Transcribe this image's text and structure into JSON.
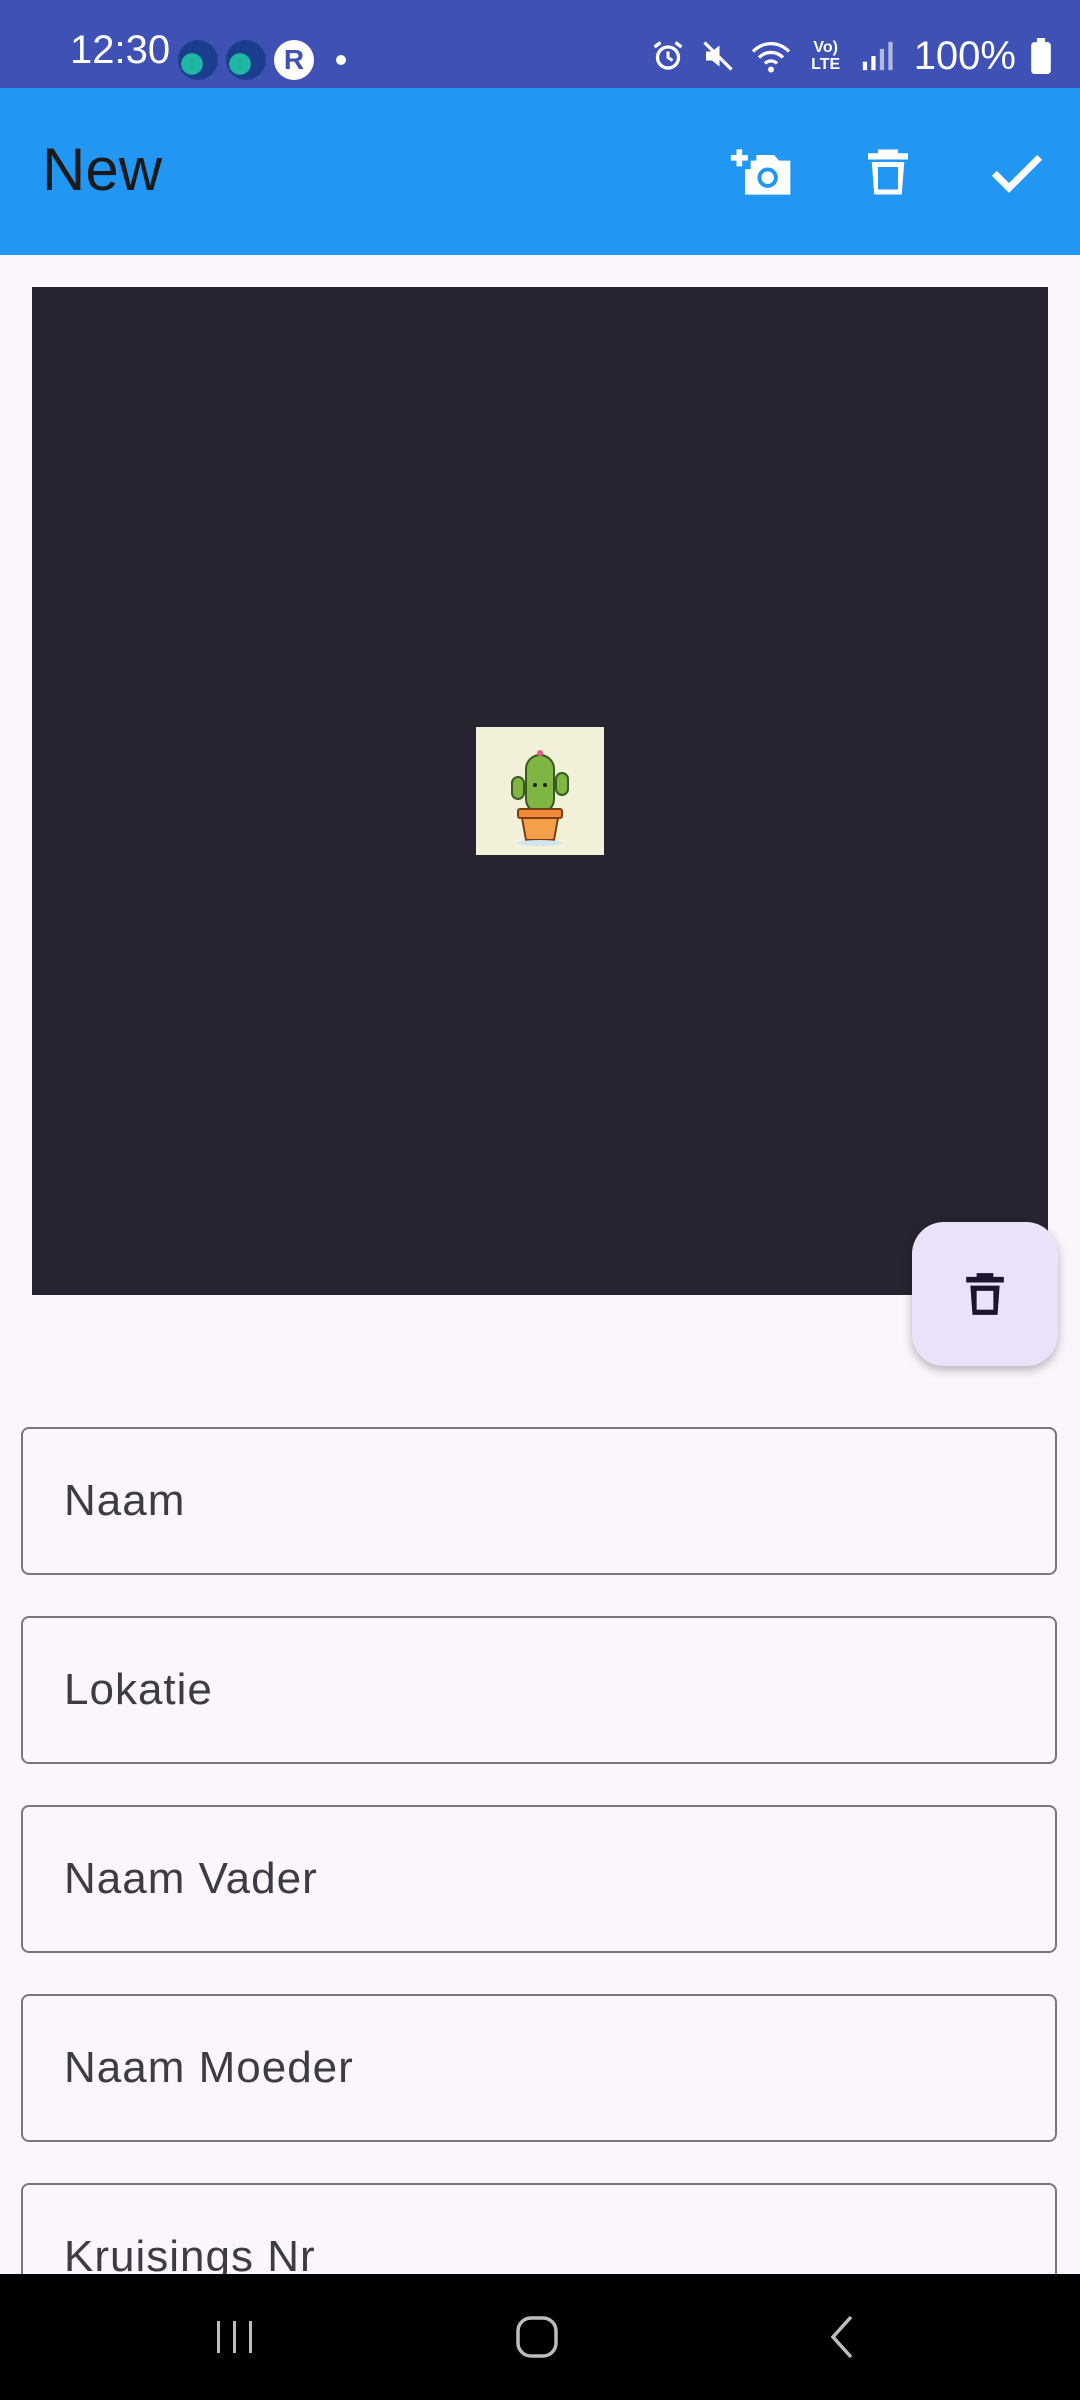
{
  "status_bar": {
    "time": "12:30",
    "battery": "100%",
    "network_badge": "Vo) LTE",
    "icons": [
      "app-icon-1",
      "app-icon-2",
      "app-r-icon",
      "notification-dot",
      "alarm-icon",
      "mute-icon",
      "wifi-icon",
      "lte-icon",
      "signal-icon",
      "battery-icon"
    ]
  },
  "app_bar": {
    "title": "New",
    "actions": [
      "add-photo-icon",
      "delete-icon",
      "check-icon"
    ]
  },
  "image": {
    "thumbnail": "cactus-image"
  },
  "fab": {
    "icon": "delete-icon"
  },
  "form": {
    "fields": [
      {
        "label": "Naam"
      },
      {
        "label": "Lokatie"
      },
      {
        "label": "Naam Vader"
      },
      {
        "label": "Naam Moeder"
      },
      {
        "label": "Kruisings Nr"
      }
    ]
  },
  "nav_bar": {
    "buttons": [
      "recents-icon",
      "home-icon",
      "back-icon"
    ]
  },
  "colors": {
    "status_bar": "#3f51b5",
    "app_bar": "#2196f3",
    "background": "#fbf6fc",
    "image_bg": "#262430",
    "fab_bg": "#ebe2fa"
  }
}
